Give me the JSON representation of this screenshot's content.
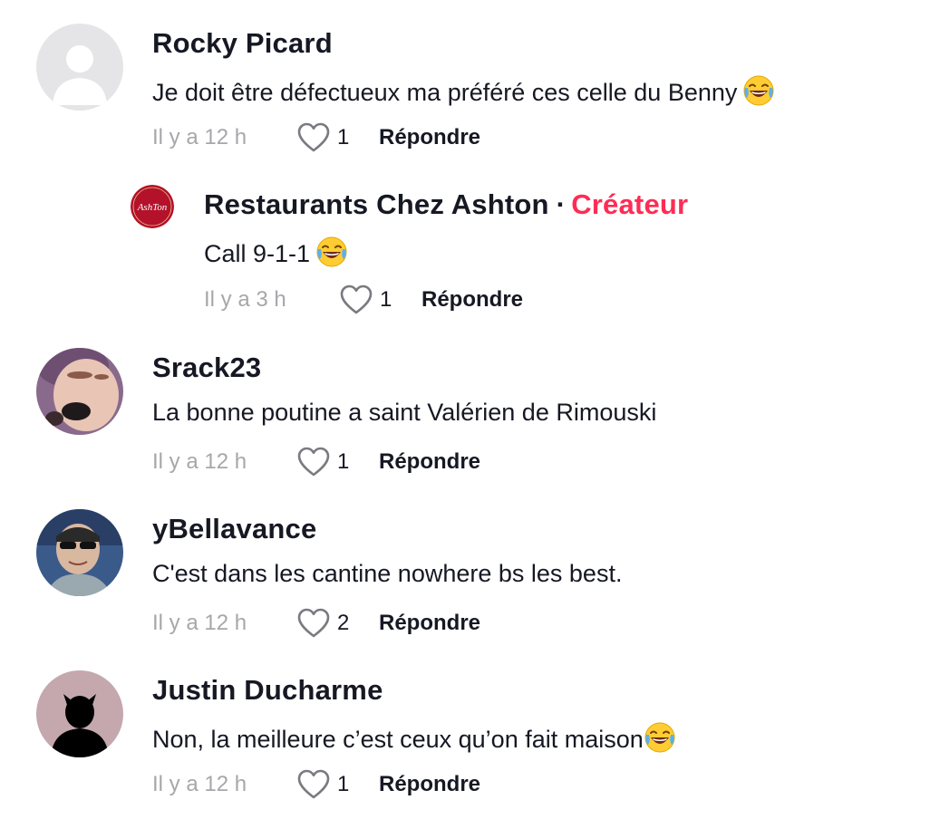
{
  "comments": [
    {
      "username": "Rocky Picard",
      "text": "Je doit être défectueux ma préféré ces celle du Benny",
      "emoji": "laughing-tears-emoji",
      "time": "Il y a 12 h",
      "likes": "1",
      "reply_label": "Répondre"
    },
    {
      "username": "Restaurants Chez Ashton",
      "separator": "·",
      "badge": "Créateur",
      "avatar_logo_text": "AshTon",
      "text": "Call 9-1-1",
      "emoji": "laughing-tears-emoji",
      "time": "Il y a 3 h",
      "likes": "1",
      "reply_label": "Répondre"
    },
    {
      "username": "Srack23",
      "text": "La bonne poutine a saint Valérien de Rimouski",
      "time": "Il y a 12 h",
      "likes": "1",
      "reply_label": "Répondre"
    },
    {
      "username": "yBellavance",
      "text": "C'est dans les cantine nowhere bs les best.",
      "time": "Il y a 12 h",
      "likes": "2",
      "reply_label": "Répondre"
    },
    {
      "username": "Justin Ducharme",
      "text": "Non, la meilleure c’est ceux qu’on fait maison",
      "emoji": "laughing-tears-emoji",
      "time": "Il y a 12 h",
      "likes": "1",
      "reply_label": "Répondre"
    }
  ],
  "colors": {
    "creator_badge": "#fe2c55",
    "timestamp": "#a7a7ab",
    "text": "#161823",
    "logo_red": "#b3122a"
  }
}
